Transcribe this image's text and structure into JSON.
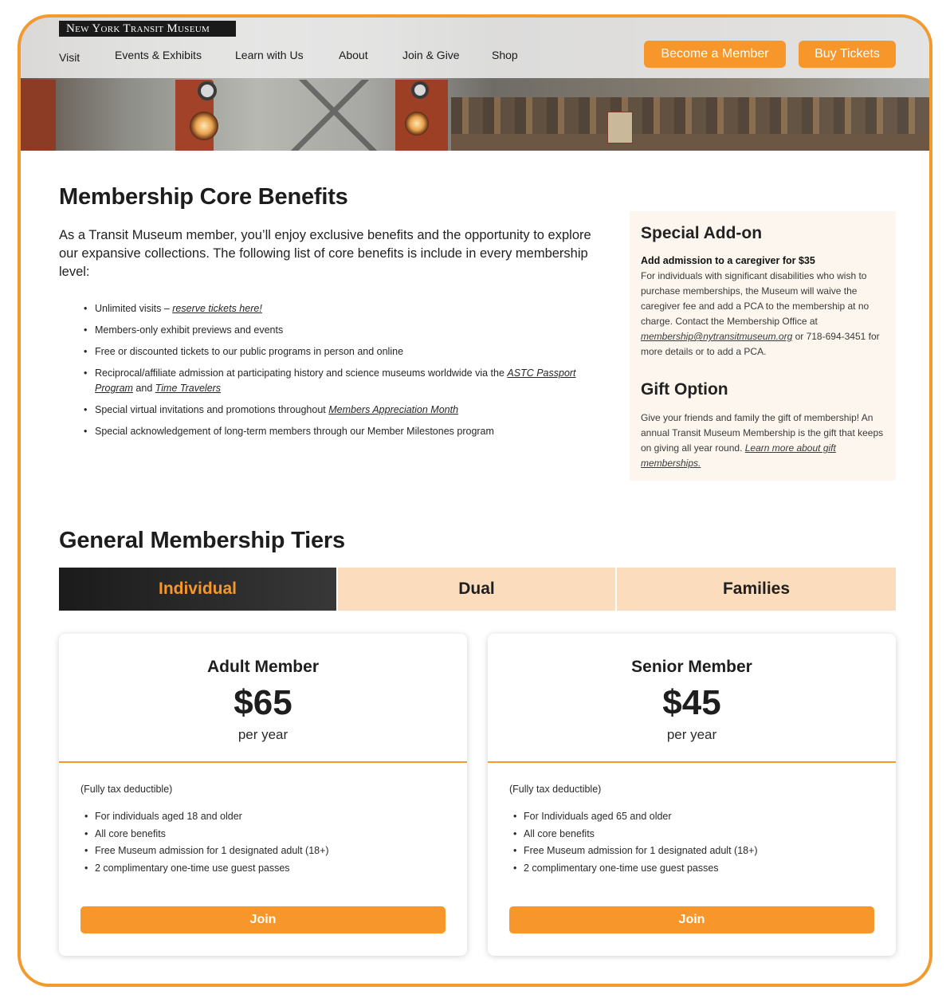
{
  "header": {
    "logo_text": "New York Transit Museum",
    "nav": [
      "Visit",
      "Events & Exhibits",
      "Learn with Us",
      "About",
      "Join & Give",
      "Shop"
    ],
    "become_member": "Become a Member",
    "buy_tickets": "Buy Tickets"
  },
  "core": {
    "title": "Membership Core Benefits",
    "intro": "As a Transit Museum member, you’ll enjoy exclusive benefits and the opportunity to explore our expansive collections. The following list of core benefits is include in every membership level:",
    "benefits": {
      "b1_text": "Unlimited visits – ",
      "b1_link": "reserve tickets here!",
      "b2": "Members-only exhibit previews and events",
      "b3": "Free or discounted tickets to our public programs in person and online",
      "b4_text": "Reciprocal/affiliate admission at participating history and science museums worldwide via the ",
      "b4_link1": "ASTC Passport Program",
      "b4_mid": " and ",
      "b4_link2": "Time Travelers",
      "b5_text": "Special virtual invitations and promotions throughout ",
      "b5_link": "Members Appreciation Month",
      "b6": "Special acknowledgement of long-term members through our Member Milestones program"
    }
  },
  "sidebar": {
    "addon_title": "Special Add-on",
    "addon_strong": "Add admission to a caregiver for $35",
    "addon_text": "For individuals with significant disabilities who wish to purchase memberships, the Museum will waive the caregiver fee and add a PCA to the membership at no charge. Contact the Membership Office at ",
    "addon_email": "membership@nytransitmuseum.org",
    "addon_text2": " or 718-694-3451 for more details or to add a PCA.",
    "gift_title": "Gift Option",
    "gift_text": "Give your friends and family the gift of membership! An annual Transit Museum Membership is the gift that keeps on giving all year round. ",
    "gift_link": "Learn more about gift memberships."
  },
  "tiers": {
    "title": "General Membership Tiers",
    "tabs": [
      "Individual",
      "Dual",
      "Families"
    ],
    "active_tab": "Individual",
    "cards": [
      {
        "name": "Adult Member",
        "price": "$65",
        "period": "per year",
        "tax": "(Fully tax deductible)",
        "items": [
          "For individuals aged 18 and older",
          "All core benefits",
          "Free Museum admission for 1 designated adult (18+)",
          "2 complimentary one-time use guest passes"
        ],
        "cta": "Join"
      },
      {
        "name": "Senior Member",
        "price": "$45",
        "period": "per year",
        "tax": "(Fully tax deductible)",
        "items": [
          "For Individuals aged 65 and older",
          "All core benefits",
          "Free Museum admission for 1 designated adult (18+)",
          "2 complimentary one-time use guest passes"
        ],
        "cta": "Join"
      }
    ]
  },
  "colors": {
    "accent": "#f7962a",
    "frame": "#f39a2e",
    "tab_inactive": "#fbdcbd",
    "sidebar_bg": "#fdf6ee"
  }
}
